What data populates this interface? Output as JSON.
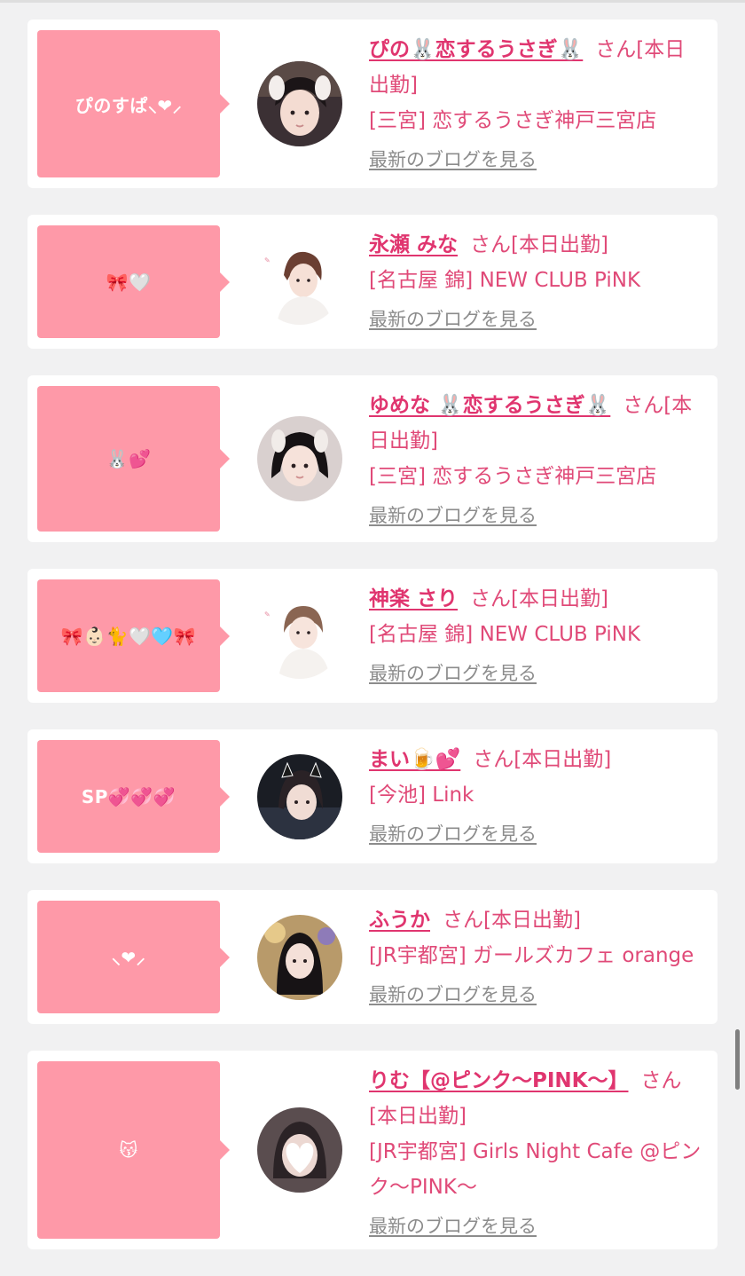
{
  "cards": [
    {
      "bubble": "ぴのすぱ⸜❤︎⸝",
      "name": "ぴの🐰恋するうさぎ🐰",
      "san": "さん",
      "status": "[本日出勤]",
      "shop": "[三宮] 恋するうさぎ神戸三宮店",
      "blog": "最新のブログを見る"
    },
    {
      "bubble": "🎀🤍",
      "name": "永瀬 みな",
      "san": "さん",
      "status": "[本日出勤]",
      "shop": "[名古屋 錦] NEW CLUB PiNK",
      "blog": "最新のブログを見る"
    },
    {
      "bubble": "🐰💕",
      "name": "ゆめな 🐰恋するうさぎ🐰",
      "san": "さん",
      "status": "[本日出勤]",
      "shop": "[三宮] 恋するうさぎ神戸三宮店",
      "blog": "最新のブログを見る"
    },
    {
      "bubble": "🎀👶🏻🐈🤍🩵🎀",
      "name": "神楽 さり",
      "san": "さん",
      "status": "[本日出勤]",
      "shop": "[名古屋 錦] NEW CLUB PiNK",
      "blog": "最新のブログを見る"
    },
    {
      "bubble": "SP💞💞💞",
      "name": "まい🍺💕",
      "san": "さん",
      "status": "[本日出勤]",
      "shop": "[今池] Link",
      "blog": "最新のブログを見る"
    },
    {
      "bubble": "⸜❤︎⸝",
      "name": "ふうか",
      "san": "さん",
      "status": "[本日出勤]",
      "shop": "[JR宇都宮] ガールズカフェ orange",
      "blog": "最新のブログを見る"
    },
    {
      "bubble": "😽",
      "name": "りむ【@ピンク～PINK～】",
      "san": "さん",
      "status": "[本日出勤]",
      "shop": "[JR宇都宮] Girls Night Cafe @ピンク～PINK～",
      "blog": "最新のブログを見る"
    }
  ],
  "colors": {
    "accent": "#e0356f",
    "bubble": "#fe99a8",
    "background": "#f1f1f2",
    "link_gray": "#8c8c8c"
  }
}
